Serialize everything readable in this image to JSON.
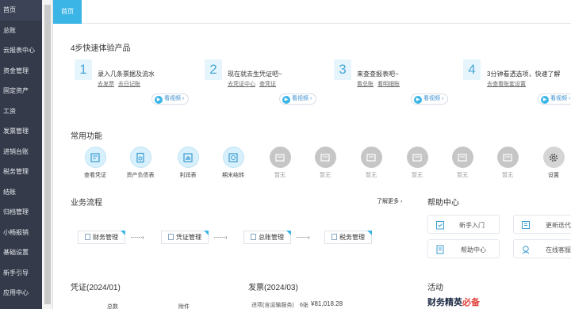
{
  "sidebar": {
    "items": [
      "首页",
      "总账",
      "云报表中心",
      "资金管理",
      "固定资产",
      "工资",
      "发票管理",
      "进销台账",
      "税务管理",
      "结账",
      "归档管理",
      "小畅报销",
      "基础设置",
      "新手引导",
      "应用中心"
    ]
  },
  "topbar": {
    "active_tab": "首页"
  },
  "quickstart": {
    "title": "4步快速体验产品",
    "video_label": "看视频",
    "steps": [
      {
        "num": "1",
        "title": "录入几条票据及流水",
        "links": [
          "去发票",
          "去日记账"
        ]
      },
      {
        "num": "2",
        "title": "现在就去生凭证吧~",
        "links": [
          "去凭证中心",
          "查凭证"
        ]
      },
      {
        "num": "3",
        "title": "来查查报表吧~",
        "links": [
          "看总账",
          "看明细账"
        ]
      },
      {
        "num": "4",
        "title": "3分钟看透选项，快速了解",
        "links": [
          "去查看账套设置"
        ]
      }
    ]
  },
  "common": {
    "title": "常用功能",
    "items": [
      {
        "label": "查看凭证",
        "icon": "voucher-icon",
        "enabled": true
      },
      {
        "label": "资产负债表",
        "icon": "balance-sheet-icon",
        "enabled": true
      },
      {
        "label": "利润表",
        "icon": "profit-chart-icon",
        "enabled": true
      },
      {
        "label": "期末结转",
        "icon": "period-close-icon",
        "enabled": true
      },
      {
        "label": "暂无",
        "icon": "placeholder-icon",
        "enabled": false
      },
      {
        "label": "暂无",
        "icon": "placeholder-icon",
        "enabled": false
      },
      {
        "label": "暂无",
        "icon": "placeholder-icon",
        "enabled": false
      },
      {
        "label": "暂无",
        "icon": "placeholder-icon",
        "enabled": false
      },
      {
        "label": "暂无",
        "icon": "placeholder-icon",
        "enabled": false
      },
      {
        "label": "暂无",
        "icon": "placeholder-icon",
        "enabled": false
      },
      {
        "label": "设置",
        "icon": "gear-icon",
        "enabled": true
      }
    ]
  },
  "workflow": {
    "title": "业务流程",
    "more": "了解更多",
    "steps": [
      "财务管理",
      "凭证管理",
      "总账管理",
      "税务管理"
    ]
  },
  "help": {
    "title": "帮助中心",
    "items": [
      "新手入门",
      "更新迭代",
      "帮助中心",
      "在线客服"
    ]
  },
  "voucher": {
    "title": "凭证(2024/01)",
    "col1": "总数",
    "col2": "附件"
  },
  "invoice": {
    "title": "发票(2024/03)",
    "row_label": "进项(含运输服务)",
    "row_count": "6张",
    "row_amount": "¥81,018.28"
  },
  "activity": {
    "title": "活动",
    "banner_text": "财务精英",
    "banner_accent": "必备"
  },
  "colors": {
    "accent": "#3bb5e6",
    "sidebar": "#343a4a"
  }
}
